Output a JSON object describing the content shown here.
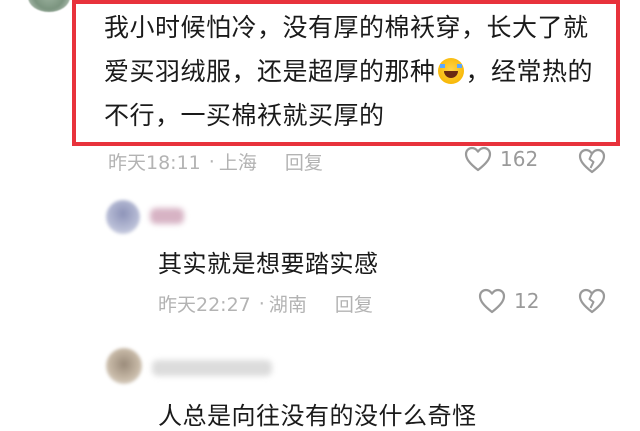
{
  "comments": [
    {
      "text_part1": "我小时候怕冷，没有厚的棉袄穿，长大了就爱买羽绒服，还是超厚的那种",
      "text_part2": "，经常热的不行，一买棉袄就买厚的",
      "emoji": "rolling-on-floor-laughing-emoji",
      "time": "昨天18:11",
      "location": "上海",
      "reply_label": "回复",
      "likes": "162"
    },
    {
      "text": "其实就是想要踏实感",
      "time": "昨天22:27",
      "location": "湖南",
      "reply_label": "回复",
      "likes": "12"
    },
    {
      "text": "人总是向往没有的没什么奇怪"
    }
  ],
  "colors": {
    "highlight_border": "#e8323c",
    "meta_text": "#b3b3b3",
    "icon": "#9a9a9a"
  }
}
